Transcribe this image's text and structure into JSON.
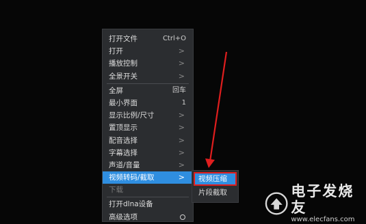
{
  "context_menu": {
    "items": [
      {
        "label": "打开文件",
        "shortcut": "Ctrl+O",
        "submenu": false,
        "disabled": false,
        "active": false
      },
      {
        "label": "打开",
        "shortcut": "",
        "submenu": true,
        "disabled": false,
        "active": false
      },
      {
        "label": "播放控制",
        "shortcut": "",
        "submenu": true,
        "disabled": false,
        "active": false
      },
      {
        "label": "全景开关",
        "shortcut": "",
        "submenu": true,
        "disabled": false,
        "active": false
      },
      {
        "label": "全屏",
        "shortcut": "回车",
        "submenu": false,
        "disabled": false,
        "active": false
      },
      {
        "label": "最小界面",
        "shortcut": "1",
        "submenu": false,
        "disabled": false,
        "active": false
      },
      {
        "label": "显示比例/尺寸",
        "shortcut": "",
        "submenu": true,
        "disabled": false,
        "active": false
      },
      {
        "label": "置顶显示",
        "shortcut": "",
        "submenu": true,
        "disabled": false,
        "active": false
      },
      {
        "label": "配音选择",
        "shortcut": "",
        "submenu": true,
        "disabled": false,
        "active": false
      },
      {
        "label": "字幕选择",
        "shortcut": "",
        "submenu": true,
        "disabled": false,
        "active": false
      },
      {
        "label": "声道/音量",
        "shortcut": "",
        "submenu": true,
        "disabled": false,
        "active": false
      },
      {
        "label": "视频转码/截取",
        "shortcut": "",
        "submenu": true,
        "disabled": false,
        "active": true
      },
      {
        "label": "下载",
        "shortcut": "",
        "submenu": false,
        "disabled": true,
        "active": false
      },
      {
        "label": "打开dlna设备",
        "shortcut": "",
        "submenu": false,
        "disabled": false,
        "active": false
      },
      {
        "label": "高级选项",
        "shortcut": "",
        "submenu": false,
        "disabled": false,
        "active": false
      }
    ],
    "arrow_glyph": ">"
  },
  "submenu": {
    "items": [
      {
        "label": "视频压缩",
        "highlighted": true
      },
      {
        "label": "片段截取",
        "highlighted": false
      }
    ]
  },
  "annotation": {
    "arrow_color": "#e01e1e",
    "box_color": "#e01e1e"
  },
  "watermark": {
    "title": "电子发烧友",
    "url": "www.elecfans.com"
  },
  "colors": {
    "background": "#060606",
    "menu_bg": "#2b2d30",
    "accent": "#2f8ee0",
    "text": "#dcdcdc",
    "disabled_text": "#7a7a7a"
  }
}
